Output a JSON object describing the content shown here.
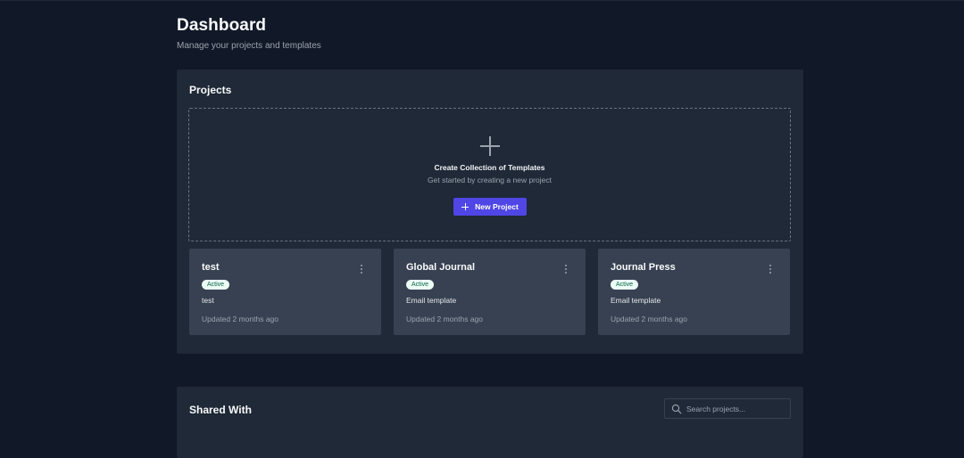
{
  "header": {
    "title": "Dashboard",
    "subtitle": "Manage your projects and templates"
  },
  "projects": {
    "title": "Projects",
    "create": {
      "icon": "plus-icon",
      "title": "Create Collection of Templates",
      "subtitle": "Get started by creating a new project",
      "button_label": "New Project"
    },
    "cards": [
      {
        "title": "test",
        "status": "Active",
        "description": "test",
        "updated": "Updated 2 months ago"
      },
      {
        "title": "Global Journal",
        "status": "Active",
        "description": "Email template",
        "updated": "Updated 2 months ago"
      },
      {
        "title": "Journal Press",
        "status": "Active",
        "description": "Email template",
        "updated": "Updated 2 months ago"
      }
    ]
  },
  "shared": {
    "title": "Shared With",
    "search": {
      "placeholder": "Search projects...",
      "value": ""
    }
  },
  "colors": {
    "background": "#111827",
    "panel": "#1f2937",
    "card": "#374151",
    "accent": "#4f46e5",
    "badge_bg": "#ecfdf5",
    "badge_text": "#065f46"
  }
}
